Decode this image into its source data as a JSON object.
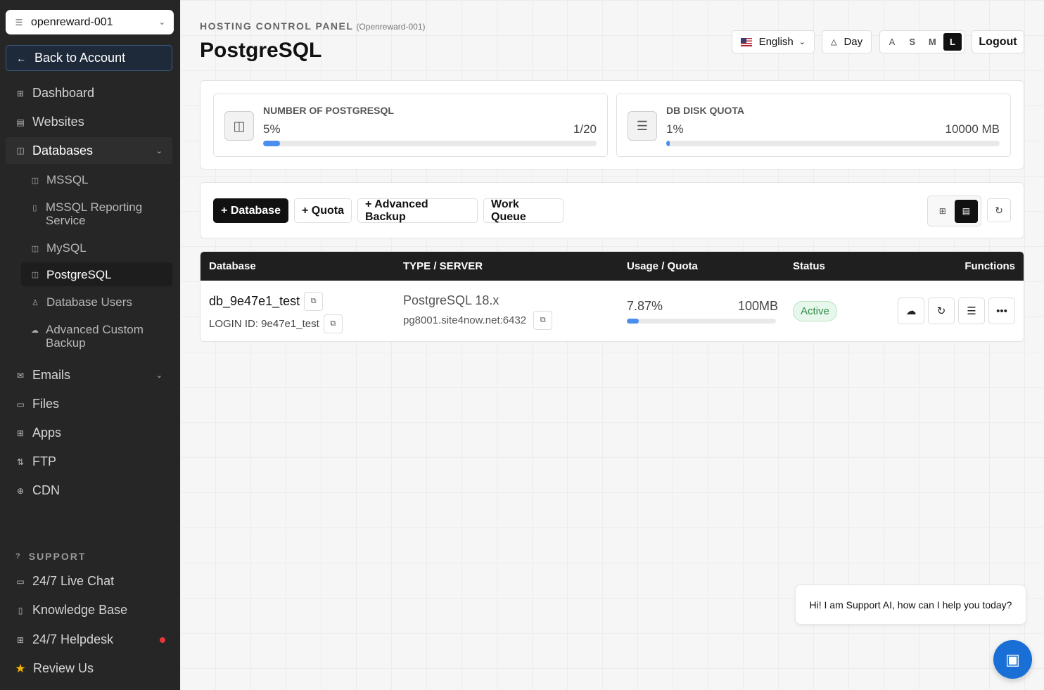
{
  "sidebar": {
    "account": "openreward-001",
    "back": "Back to Account",
    "nav": {
      "dashboard": "Dashboard",
      "websites": "Websites",
      "databases": "Databases",
      "emails": "Emails",
      "files": "Files",
      "apps": "Apps",
      "ftp": "FTP",
      "cdn": "CDN"
    },
    "db_sub": {
      "mssql": "MSSQL",
      "mssql_rs": "MSSQL Reporting Service",
      "mysql": "MySQL",
      "postgresql": "PostgreSQL",
      "db_users": "Database Users",
      "adv_backup": "Advanced Custom Backup"
    },
    "support": {
      "header": "SUPPORT",
      "live_chat": "24/7 Live Chat",
      "kb": "Knowledge Base",
      "helpdesk": "24/7 Helpdesk",
      "review": "Review Us"
    }
  },
  "header": {
    "panel_label": "HOSTING CONTROL PANEL",
    "panel_sub": "(Openreward-001)",
    "title": "PostgreSQL",
    "language": "English",
    "theme": "Day",
    "font_sizes": [
      "S",
      "M",
      "L"
    ],
    "font_selected": "L",
    "logout": "Logout"
  },
  "stats": {
    "count": {
      "label": "NUMBER OF POSTGRESQL",
      "pct": "5%",
      "value": "1/20",
      "fill": 0.05
    },
    "disk": {
      "label": "DB DISK QUOTA",
      "pct": "1%",
      "value": "10000 MB",
      "fill": 0.01
    }
  },
  "actions": {
    "add_db": "+ Database",
    "quota": "+ Quota",
    "adv_backup": "+ Advanced Backup",
    "work_queue": "Work Queue"
  },
  "table": {
    "headers": {
      "database": "Database",
      "type": "TYPE / SERVER",
      "usage": "Usage / Quota",
      "status": "Status",
      "functions": "Functions"
    },
    "rows": [
      {
        "name": "db_9e47e1_test",
        "login": "LOGIN ID: 9e47e1_test",
        "type": "PostgreSQL 18.x",
        "server": "pg8001.site4now.net:6432",
        "usage_pct": "7.87%",
        "quota": "100MB",
        "usage_fill": 0.0787,
        "status": "Active"
      }
    ]
  },
  "chat": {
    "bubble": "Hi! I am Support AI, how can I help you today?"
  },
  "colors": {
    "accent": "#4a8ef0",
    "status_active": "#2e8b47",
    "sidebar_bg": "#262626",
    "chat": "#1a6fd6"
  }
}
